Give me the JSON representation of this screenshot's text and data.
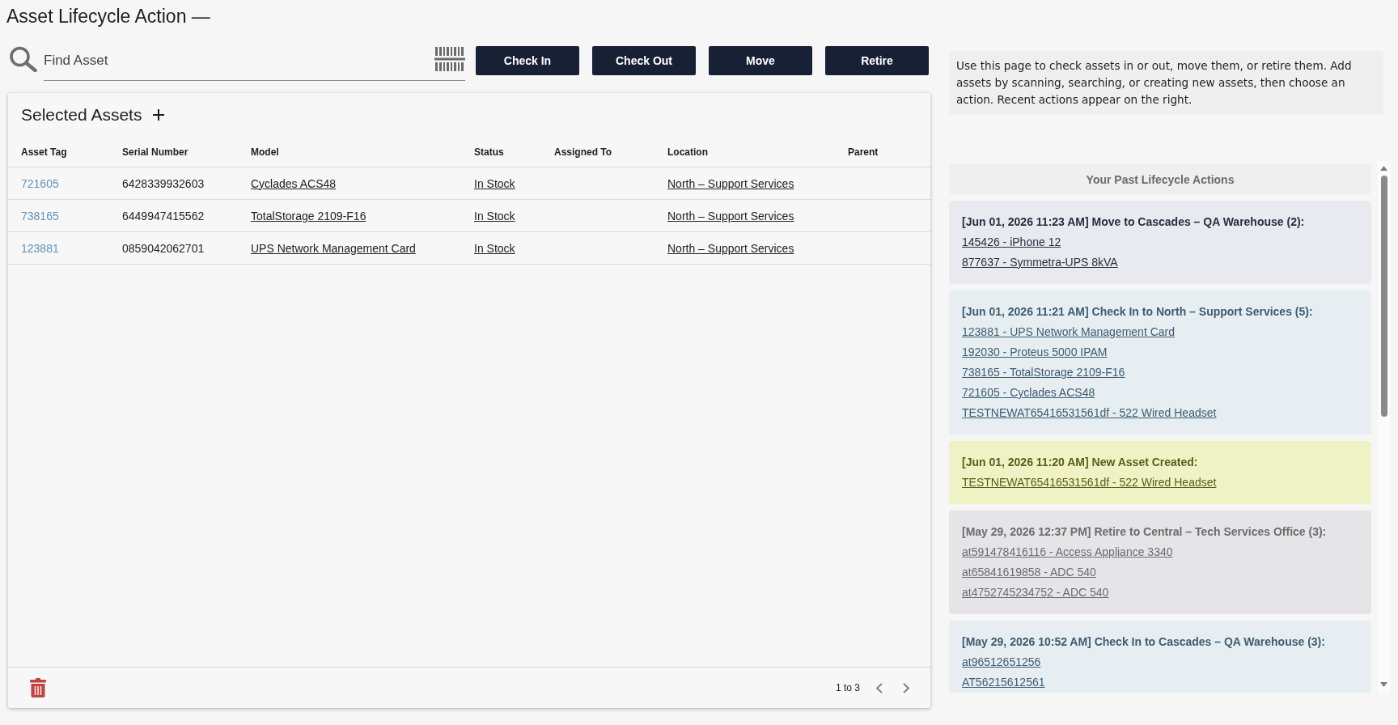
{
  "page": {
    "title": "Asset Lifecycle Action —"
  },
  "search": {
    "placeholder": "Find Asset"
  },
  "actions": [
    "Check In",
    "Check Out",
    "Move",
    "Retire"
  ],
  "selected_assets": {
    "title": "Selected Assets",
    "columns": [
      "Asset Tag",
      "Serial Number",
      "Model",
      "Status",
      "Assigned To",
      "Location",
      "Parent"
    ],
    "rows": [
      {
        "asset_tag": "721605",
        "serial_number": "6428339932603",
        "model": "Cyclades ACS48",
        "status": "In Stock",
        "location": "North – Support Services"
      },
      {
        "asset_tag": "738165",
        "serial_number": "6449947415562",
        "model": "TotalStorage 2109-F16",
        "status": "In Stock",
        "location": "North – Support Services"
      },
      {
        "asset_tag": "123881",
        "serial_number": "0859042062701",
        "model": "UPS Network Management Card",
        "status": "In Stock",
        "location": "North – Support Services"
      }
    ],
    "pagination": "1 to 3"
  },
  "help_text": "Use this page to check assets in or out, move them, or retire them. Add assets by scanning, searching, or creating new assets, then choose an action. Recent actions appear on the right.",
  "past_actions": {
    "title": "Your Past Lifecycle Actions",
    "items": [
      {
        "kind": "move",
        "title": "[Jun 01, 2026 11:23 AM] Move to Cascades – QA Warehouse (2):",
        "assets": [
          "145426 - iPhone 12",
          "877637 - Symmetra-UPS 8kVA"
        ]
      },
      {
        "kind": "check_in",
        "title": "[Jun 01, 2026 11:21 AM] Check In to North – Support Services (5):",
        "assets": [
          "123881 - UPS Network Management Card",
          "192030 - Proteus 5000 IPAM",
          "738165 - TotalStorage 2109-F16",
          "721605 - Cyclades ACS48",
          "TESTNEWAT65416531561df - 522 Wired Headset"
        ]
      },
      {
        "kind": "new_asset",
        "title": "[Jun 01, 2026 11:20 AM] New Asset Created:",
        "assets": [
          "TESTNEWAT65416531561df - 522 Wired Headset"
        ]
      },
      {
        "kind": "retire",
        "title": "[May 29, 2026 12:37 PM] Retire to Central – Tech Services Office (3):",
        "assets": [
          "at591478416116 - Access Appliance 3340",
          "at65841619858 - ADC 540",
          "at4752745234752 - ADC 540"
        ]
      },
      {
        "kind": "check_in",
        "title": "[May 29, 2026 10:52 AM] Check In to Cascades – QA Warehouse (3):",
        "assets": [
          "at96512651256",
          "AT56215612561"
        ]
      }
    ]
  }
}
